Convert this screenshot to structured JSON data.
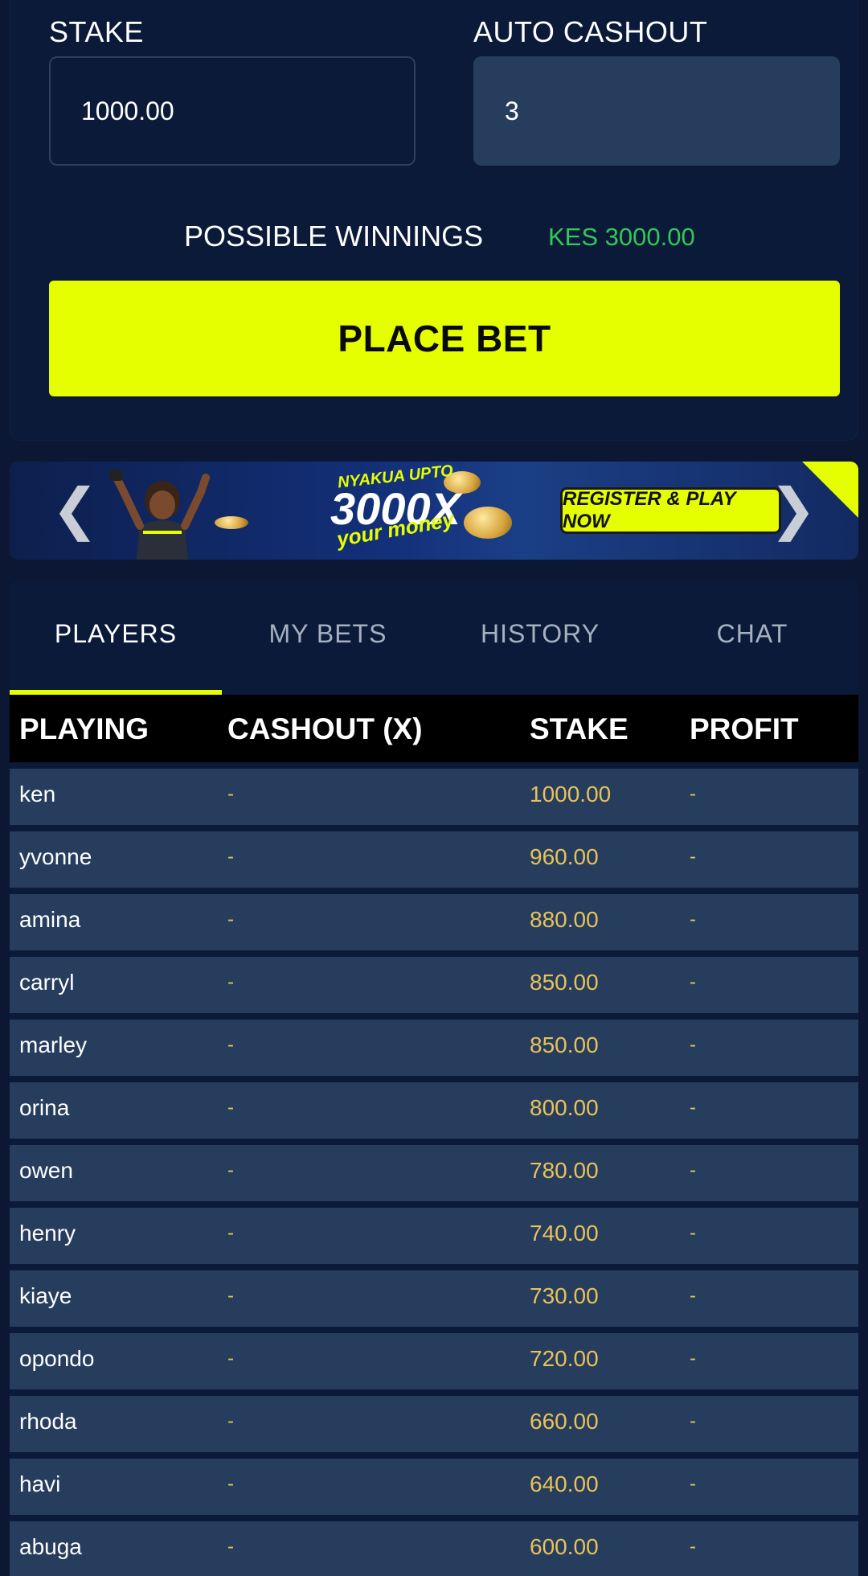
{
  "bet_form": {
    "stake_label": "STAKE",
    "stake_value": "1000.00",
    "auto_cashout_label": "AUTO CASHOUT",
    "auto_cashout_value": "3",
    "possible_winnings_label": "POSSIBLE WINNINGS",
    "possible_winnings_value": "KES 3000.00",
    "place_bet_label": "PLACE BET"
  },
  "banner": {
    "tagline_top": "NYAKUA UPTO",
    "multiplier": "3000X",
    "tagline_script": "your money",
    "cta": "REGISTER & PLAY NOW"
  },
  "tabs": [
    {
      "label": "PLAYERS",
      "active": true
    },
    {
      "label": "MY BETS",
      "active": false
    },
    {
      "label": "HISTORY",
      "active": false
    },
    {
      "label": "CHAT",
      "active": false
    }
  ],
  "table": {
    "headers": [
      "PLAYING",
      "CASHOUT (X)",
      "STAKE",
      "PROFIT"
    ],
    "rows": [
      {
        "player": "ken",
        "cashout": "-",
        "stake": "1000.00",
        "profit": "-"
      },
      {
        "player": "yvonne",
        "cashout": "-",
        "stake": "960.00",
        "profit": "-"
      },
      {
        "player": "amina",
        "cashout": "-",
        "stake": "880.00",
        "profit": "-"
      },
      {
        "player": "carryl",
        "cashout": "-",
        "stake": "850.00",
        "profit": "-"
      },
      {
        "player": "marley",
        "cashout": "-",
        "stake": "850.00",
        "profit": "-"
      },
      {
        "player": "orina",
        "cashout": "-",
        "stake": "800.00",
        "profit": "-"
      },
      {
        "player": "owen",
        "cashout": "-",
        "stake": "780.00",
        "profit": "-"
      },
      {
        "player": "henry",
        "cashout": "-",
        "stake": "740.00",
        "profit": "-"
      },
      {
        "player": "kiaye",
        "cashout": "-",
        "stake": "730.00",
        "profit": "-"
      },
      {
        "player": "opondo",
        "cashout": "-",
        "stake": "720.00",
        "profit": "-"
      },
      {
        "player": "rhoda",
        "cashout": "-",
        "stake": "660.00",
        "profit": "-"
      },
      {
        "player": "havi",
        "cashout": "-",
        "stake": "640.00",
        "profit": "-"
      },
      {
        "player": "abuga",
        "cashout": "-",
        "stake": "600.00",
        "profit": "-"
      }
    ]
  },
  "colors": {
    "accent": "#e5ff00",
    "winnings": "#34c759",
    "stake_text": "#e8c25a",
    "row_bg": "#263d5d",
    "panel_bg": "#0a1a38"
  },
  "icons": {
    "banner_prev": "chevron-left-icon",
    "banner_next": "chevron-right-icon"
  }
}
